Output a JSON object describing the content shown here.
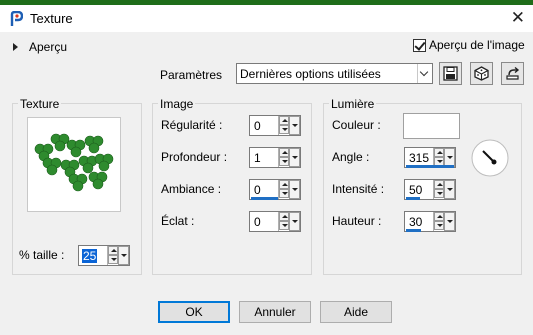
{
  "window": {
    "title": "Texture",
    "close_glyph": "✕"
  },
  "apercu": {
    "label": "Aperçu",
    "checkbox_label": "Aperçu de l'image",
    "checked": true
  },
  "params": {
    "label": "Paramètres",
    "preset_value": "Dernières options utilisées"
  },
  "groups": {
    "texture": "Texture",
    "image": "Image",
    "lumiere": "Lumière"
  },
  "texture": {
    "size_label": "% taille :",
    "size_value": "25"
  },
  "image": {
    "regularite_label": "Régularité :",
    "regularite_value": "0",
    "profondeur_label": "Profondeur :",
    "profondeur_value": "1",
    "ambiance_label": "Ambiance :",
    "ambiance_value": "0",
    "eclat_label": "Éclat :",
    "eclat_value": "0"
  },
  "lumiere": {
    "couleur_label": "Couleur :",
    "couleur_value": "#ffffff",
    "angle_label": "Angle :",
    "angle_value": "315",
    "intensite_label": "Intensité :",
    "intensite_value": "50",
    "hauteur_label": "Hauteur :",
    "hauteur_value": "30"
  },
  "buttons": {
    "ok": "OK",
    "annuler": "Annuler",
    "aide": "Aide"
  },
  "colors": {
    "accent": "#1f6fc4",
    "top_strip": "#1f6d1a",
    "clover": "#2e8b2e"
  },
  "icons": [
    "app-icon",
    "save-icon",
    "cube-icon",
    "reset-icon",
    "angle-dial-icon"
  ]
}
